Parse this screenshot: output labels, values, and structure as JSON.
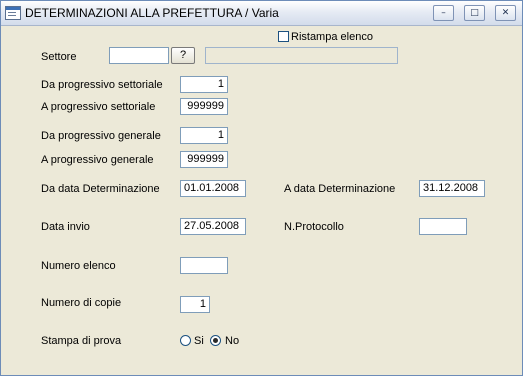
{
  "window": {
    "title": "DETERMINAZIONI ALLA PREFETTURA / Varia",
    "minimize_glyph": "–",
    "maximize_glyph": "□",
    "close_glyph": "✕"
  },
  "form": {
    "ristampa_label": "Ristampa elenco",
    "ristampa_checked": false,
    "settore_label": "Settore",
    "settore_value": "",
    "settore_lookup_label": "?",
    "settore_description": "",
    "da_prog_settoriale_label": "Da progressivo settoriale",
    "da_prog_settoriale_value": "1",
    "a_prog_settoriale_label": "A  progressivo settoriale",
    "a_prog_settoriale_value": "999999",
    "da_prog_generale_label": "Da progressivo generale",
    "da_prog_generale_value": "1",
    "a_prog_generale_label": "A  progressivo generale",
    "a_prog_generale_value": "999999",
    "da_data_label": "Da data Determinazione",
    "da_data_value": "01.01.2008",
    "a_data_label": "A data Determinazione",
    "a_data_value": "31.12.2008",
    "data_invio_label": "Data invio",
    "data_invio_value": "27.05.2008",
    "protocollo_label": "N.Protocollo",
    "protocollo_value": "",
    "numero_elenco_label": "Numero elenco",
    "numero_elenco_value": "",
    "numero_copie_label": "Numero di copie",
    "numero_copie_value": "1",
    "stampa_prova_label": "Stampa di prova",
    "stampa_prova_options": [
      "Si",
      "No"
    ],
    "stampa_prova_selected": "No"
  }
}
